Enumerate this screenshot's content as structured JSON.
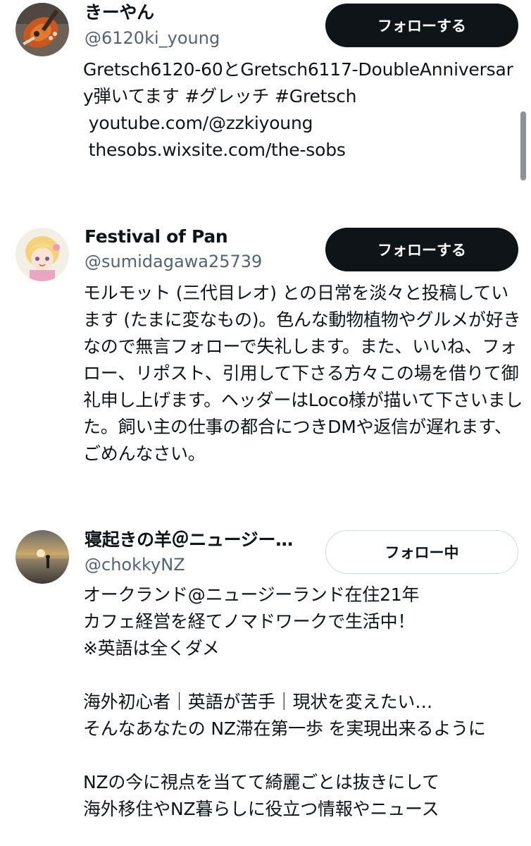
{
  "users": [
    {
      "display_name": "きーやん",
      "handle": "@6120ki_young",
      "follow_label": "フォローする",
      "bio": "Gretsch6120-60とGretsch6117-DoubleAnniversary弾いてます #グレッチ #Gretsch\n youtube.com/@zzkiyoung\n thesobs.wixsite.com/the-sobs",
      "avatar_icon": "guitar-avatar"
    },
    {
      "display_name": "Festival of Pan",
      "handle": "@sumidagawa25739",
      "follow_label": "フォローする",
      "bio": "モルモット (三代目レオ) との日常を淡々と投稿しています (たまに変なもの)。色んな動物植物やグルメが好きなので無言フォローで失礼します。また、いいね、フォロー、リポスト、引用して下さる方々この場を借りて御礼申し上げます。ヘッダーはLoco様が描いて下さいました。飼い主の仕事の都合につきDMや返信が遅れます、ごめんなさい。",
      "avatar_icon": "anime-girl-avatar"
    },
    {
      "display_name": "寝起きの羊＠ニュージー…",
      "handle": "@chokkyNZ",
      "follow_label": "フォロー中",
      "bio": "オークランド@ニュージーランド在住21年\nカフェ経営を経てノマドワークで生活中！\n※英語は全くダメ\n\n海外初心者｜英語が苦手｜現状を変えたい…\nそんなあなたの NZ滞在第一歩 を実現出来るように\n\nNZの今に視点を当てて綺麗ごとは抜きにして\n海外移住やNZ暮らしに役立つ情報やニュース",
      "avatar_icon": "beach-sunset-avatar"
    }
  ],
  "colors": {
    "primary_text": "#0f1419",
    "secondary_text": "#536471",
    "follow_button_bg": "#0f1419",
    "following_button_border": "#cfd9de"
  }
}
